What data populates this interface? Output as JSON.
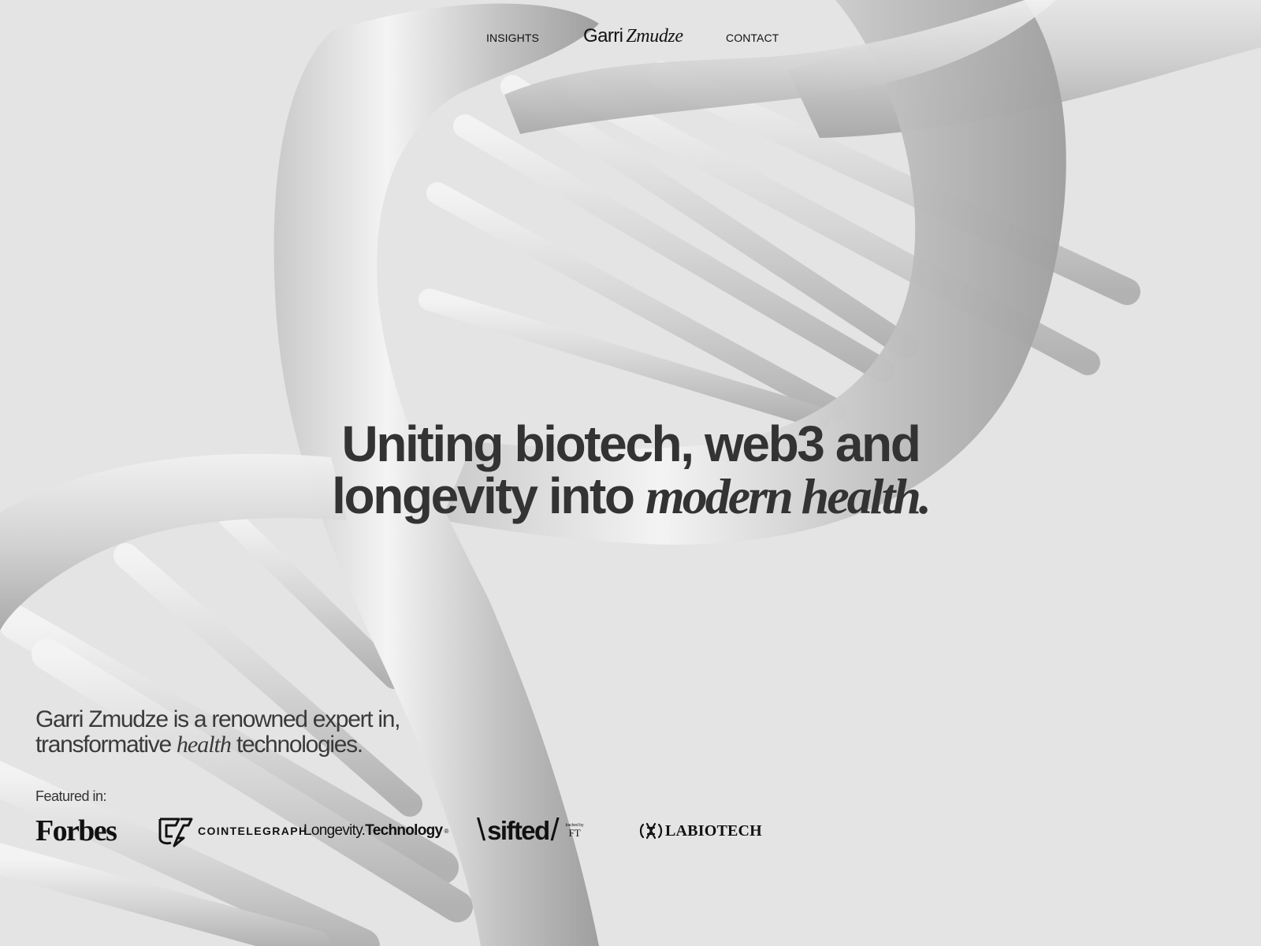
{
  "nav": {
    "insights_label": "INSIGHTS",
    "contact_label": "CONTACT",
    "brand_first": "Garri",
    "brand_last": "Zmudze"
  },
  "hero": {
    "line1": "Uniting biotech, web3 and",
    "line2_plain": "longevity into ",
    "line2_emphasis": "modern health."
  },
  "intro": {
    "line1": "Garri Zmudze is a renowned expert in,",
    "line2_before": "transformative ",
    "line2_emphasis": "health",
    "line2_after": " technologies."
  },
  "featured": {
    "label": "Featured in:",
    "logos": {
      "forbes": "Forbes",
      "cointelegraph": "COINTELEGRAPH",
      "longevity_plain": "Longevity.",
      "longevity_bold": "Technology",
      "longevity_reg": "®",
      "sifted_word": "sifted",
      "sifted_backed": "backed by",
      "sifted_ft": "FT",
      "labiotech": "LABIOTECH"
    }
  },
  "colors": {
    "background": "#e3e4e3",
    "text": "#2b2b2b",
    "dna_light": "#f2f2f2",
    "dna_dark": "#a9a9a9"
  },
  "icons": [
    "dna-helix-graphic",
    "cointelegraph-logo-icon",
    "labiotech-logo-icon"
  ]
}
